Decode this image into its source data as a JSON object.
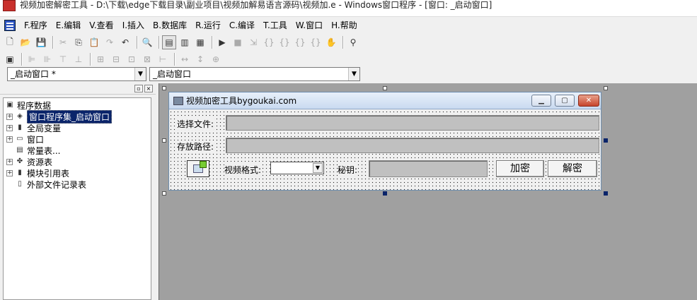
{
  "window": {
    "title": "视频加密解密工具 - D:\\下载\\edge下载目录\\副业项目\\视频加解易语言源码\\视频加.e - Windows窗口程序 - [窗口: _启动窗口]"
  },
  "menu": [
    "F.程序",
    "E.编辑",
    "V.查看",
    "I.插入",
    "B.数据库",
    "R.运行",
    "C.编译",
    "T.工具",
    "W.窗口",
    "H.帮助"
  ],
  "toolbar": {
    "row1": [
      {
        "icon": "new-file-icon",
        "glyph": "🗋"
      },
      {
        "icon": "open-folder-icon",
        "glyph": "📂"
      },
      {
        "icon": "save-icon",
        "glyph": "💾"
      },
      {
        "sep": true
      },
      {
        "icon": "cut-icon",
        "glyph": "✂",
        "disabled": true
      },
      {
        "icon": "copy-icon",
        "glyph": "⎘"
      },
      {
        "icon": "paste-icon",
        "glyph": "📋",
        "disabled": true
      },
      {
        "icon": "redo-icon",
        "glyph": "↷",
        "disabled": true
      },
      {
        "icon": "undo-icon",
        "glyph": "↶"
      },
      {
        "sep": true
      },
      {
        "icon": "find-icon",
        "glyph": "🔍"
      },
      {
        "sep": true
      },
      {
        "icon": "layout-1-icon",
        "glyph": "▤",
        "pressed": true
      },
      {
        "icon": "layout-2-icon",
        "glyph": "▥"
      },
      {
        "icon": "layout-3-icon",
        "glyph": "▦"
      },
      {
        "sep": true
      },
      {
        "icon": "run-icon",
        "glyph": "▶"
      },
      {
        "icon": "stop-icon",
        "glyph": "■",
        "disabled": true
      },
      {
        "icon": "step-1-icon",
        "glyph": "⇲",
        "disabled": true
      },
      {
        "icon": "step-2-icon",
        "glyph": "{}",
        "disabled": true
      },
      {
        "icon": "step-3-icon",
        "glyph": "{}",
        "disabled": true
      },
      {
        "icon": "step-4-icon",
        "glyph": "{}",
        "disabled": true
      },
      {
        "icon": "step-5-icon",
        "glyph": "{}",
        "disabled": true
      },
      {
        "icon": "hand-icon",
        "glyph": "✋",
        "disabled": true
      },
      {
        "sep": true
      },
      {
        "icon": "binoculars-icon",
        "glyph": "⚲"
      }
    ],
    "row2": [
      {
        "icon": "form-icon",
        "glyph": "▣"
      },
      {
        "sep": true
      },
      {
        "icon": "align-left-icon",
        "glyph": "⊫",
        "disabled": true
      },
      {
        "icon": "align-right-icon",
        "glyph": "⊪",
        "disabled": true
      },
      {
        "icon": "align-top-icon",
        "glyph": "⊤",
        "disabled": true
      },
      {
        "icon": "align-bottom-icon",
        "glyph": "⊥",
        "disabled": true
      },
      {
        "sep": true
      },
      {
        "icon": "center-h-icon",
        "glyph": "⊞",
        "disabled": true
      },
      {
        "icon": "center-v-icon",
        "glyph": "⊟",
        "disabled": true
      },
      {
        "icon": "space-h-icon",
        "glyph": "⊡",
        "disabled": true
      },
      {
        "icon": "space-v-icon",
        "glyph": "⊠",
        "disabled": true
      },
      {
        "icon": "space-even-icon",
        "glyph": "⊢",
        "disabled": true
      },
      {
        "sep": true
      },
      {
        "icon": "same-width-icon",
        "glyph": "↔",
        "disabled": true
      },
      {
        "icon": "same-height-icon",
        "glyph": "↕",
        "disabled": true
      },
      {
        "icon": "same-size-icon",
        "glyph": "⊕",
        "disabled": true
      }
    ]
  },
  "combos": {
    "left": "_启动窗口 *",
    "right": "_启动窗口"
  },
  "tree": {
    "root": "程序数据",
    "items": [
      {
        "label": "窗口程序集_启动窗口",
        "icon": "window-program-icon",
        "glyph": "◈",
        "expand": true,
        "selected": true
      },
      {
        "label": "全局变量",
        "icon": "global-var-icon",
        "glyph": "▮",
        "expand": true
      },
      {
        "label": "窗口",
        "icon": "window-icon",
        "glyph": "▭",
        "expand": true
      },
      {
        "label": "常量表...",
        "icon": "constant-table-icon",
        "glyph": "▤",
        "expand": false
      },
      {
        "label": "资源表",
        "icon": "resource-table-icon",
        "glyph": "✤",
        "expand": true
      },
      {
        "label": "模块引用表",
        "icon": "module-ref-icon",
        "glyph": "▮",
        "expand": true
      },
      {
        "label": "外部文件记录表",
        "icon": "external-file-icon",
        "glyph": "▯",
        "expand": false
      }
    ]
  },
  "form": {
    "title": "视频加密工具bygoukai.com",
    "window_buttons": {
      "minimize": "▁",
      "maximize": "▢",
      "close": "✕"
    },
    "label_select_file": "选择文件:",
    "label_save_path": "存放路径:",
    "label_format": "视频格式:",
    "label_key": "秘钥:",
    "btn_encrypt": "加密",
    "btn_decrypt": "解密"
  }
}
